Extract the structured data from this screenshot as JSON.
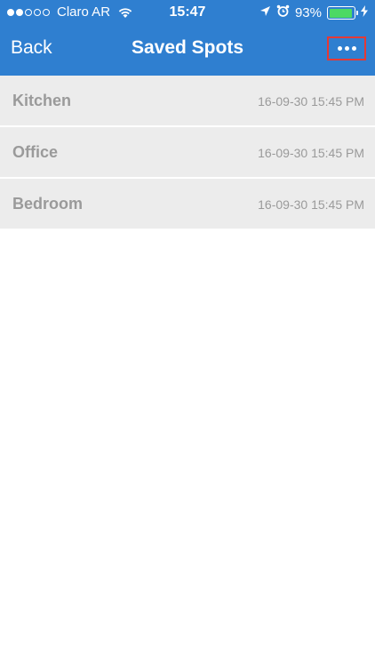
{
  "status_bar": {
    "signal": {
      "full": 2,
      "empty": 3
    },
    "carrier": "Claro AR",
    "time": "15:47",
    "battery_percent": "93%",
    "battery_level": 0.93
  },
  "nav": {
    "back_label": "Back",
    "title": "Saved Spots"
  },
  "spots": [
    {
      "name": "Kitchen",
      "time": "16-09-30 15:45 PM"
    },
    {
      "name": "Office",
      "time": "16-09-30 15:45 PM"
    },
    {
      "name": "Bedroom",
      "time": "16-09-30 15:45 PM"
    }
  ],
  "colors": {
    "header": "#2f7fd0",
    "row_bg": "#ececec",
    "row_text": "#9a9a9a",
    "more_button_highlight": "#e53935",
    "battery_fill": "#4cd964"
  }
}
